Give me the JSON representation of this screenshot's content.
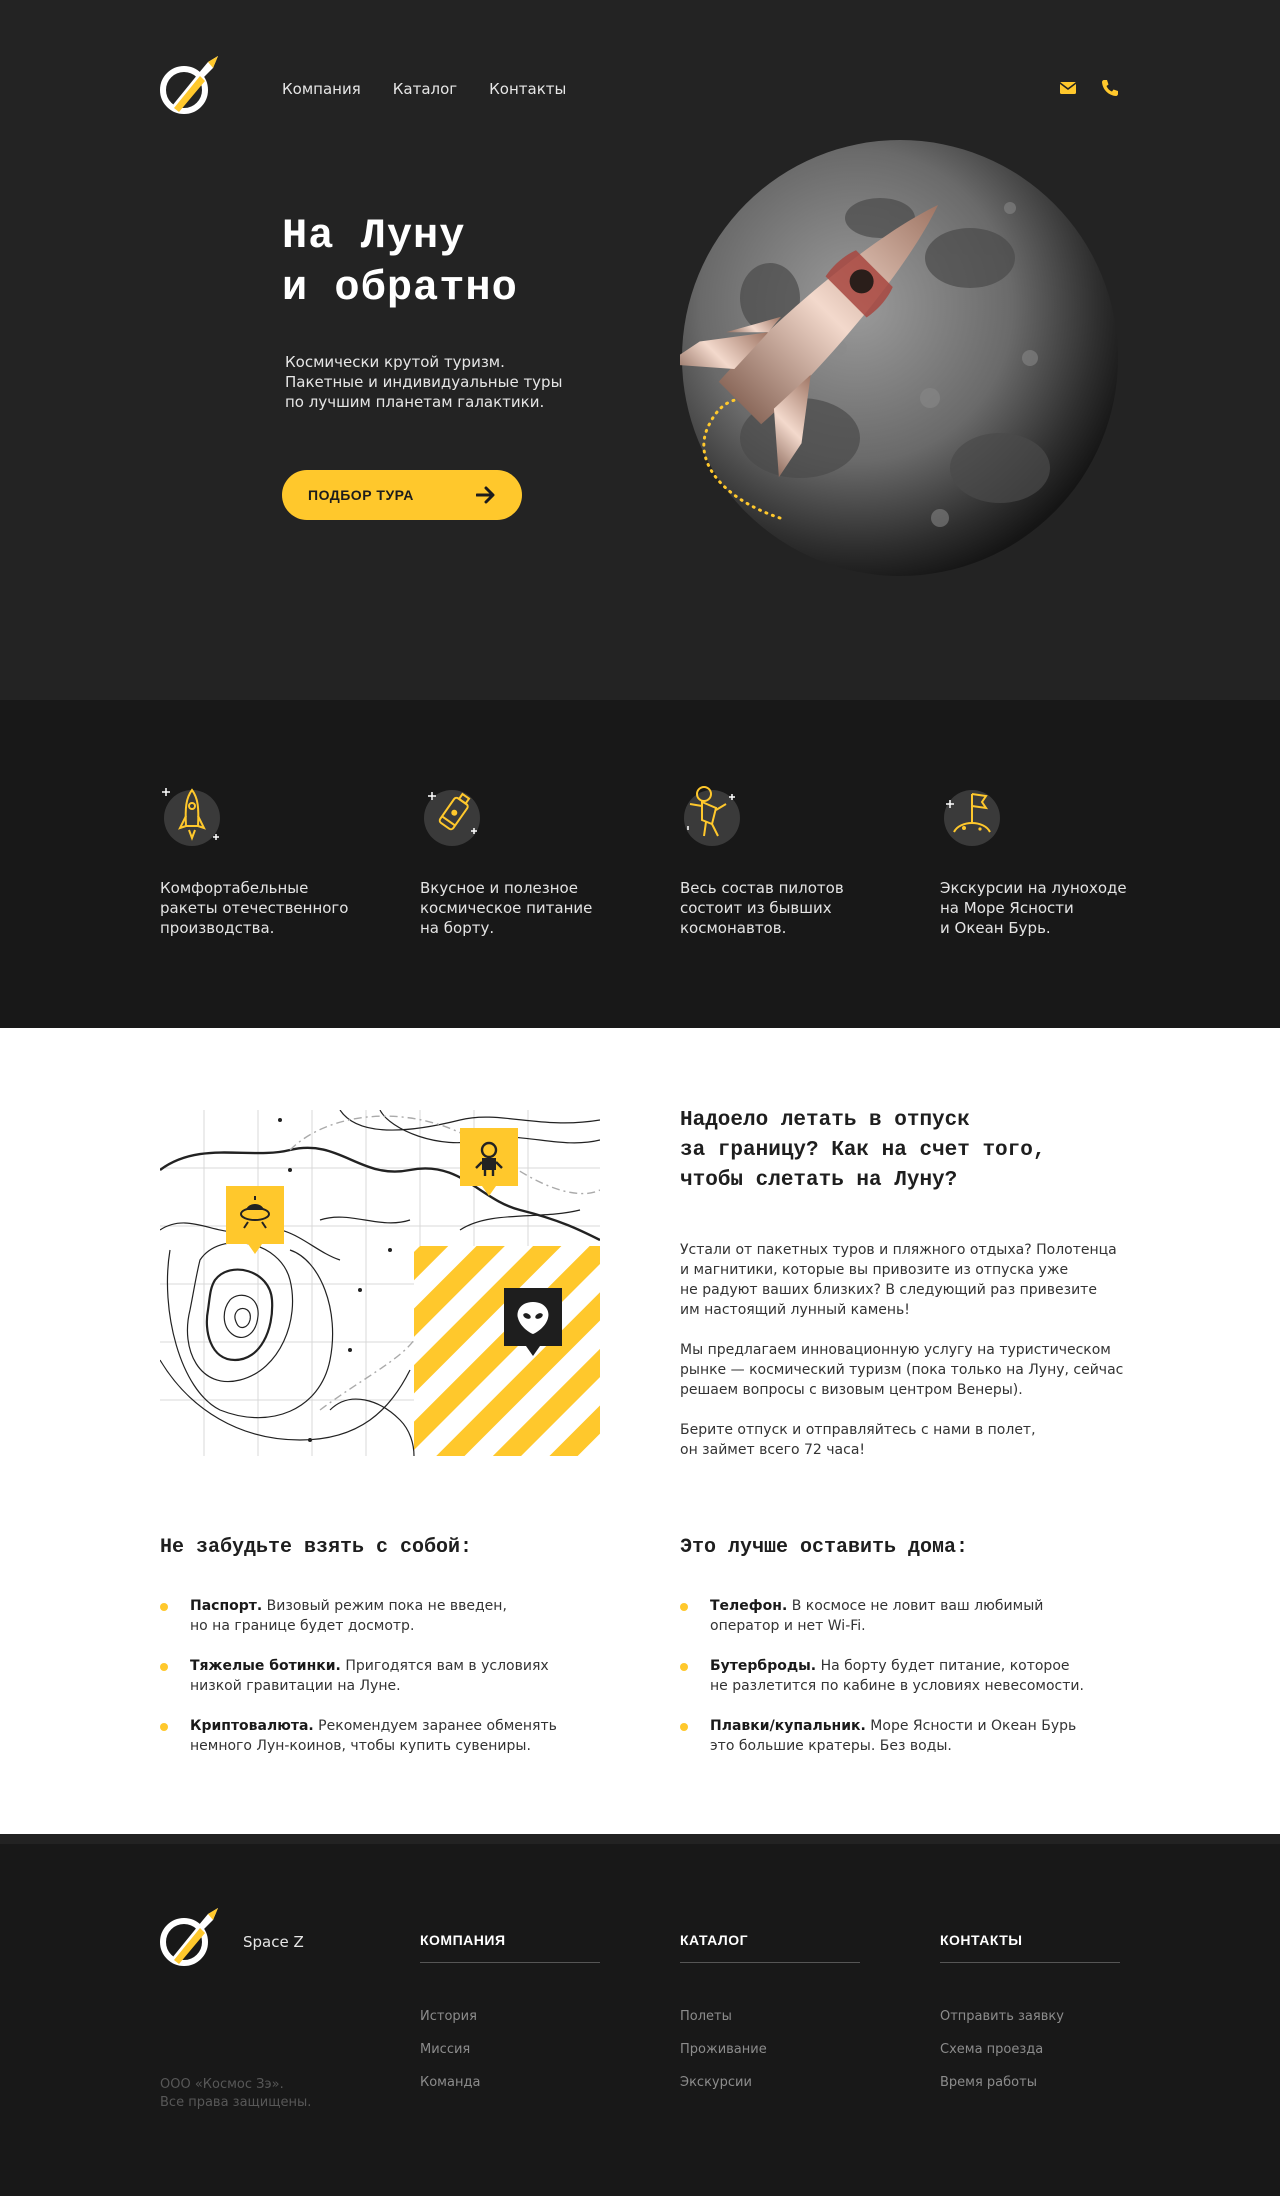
{
  "colors": {
    "accent": "#ffc82c",
    "hero_bg": "#232323",
    "dark_bg": "#181818"
  },
  "nav": {
    "items": [
      "Компания",
      "Каталог",
      "Контакты"
    ],
    "icons": [
      "mail-icon",
      "phone-icon"
    ]
  },
  "hero": {
    "title_lines": [
      "На Луну",
      "и обратно"
    ],
    "subtitle_lines": [
      "Космически крутой туризм.",
      "Пакетные и индивидуальные туры",
      "по лучшим планетам галактики."
    ],
    "cta_label": "ПОДБОР ТУРА"
  },
  "features": [
    {
      "icon": "rocket-icon",
      "lines": [
        "Комфортабельные",
        "ракеты отечественного",
        "производства."
      ]
    },
    {
      "icon": "food-tube-icon",
      "lines": [
        "Вкусное и полезное",
        "космическое питание",
        "на борту."
      ]
    },
    {
      "icon": "astronaut-icon",
      "lines": [
        "Весь состав пилотов",
        "состоит из бывших",
        "космонавтов."
      ]
    },
    {
      "icon": "moon-flag-icon",
      "lines": [
        "Экскурсии на луноходе",
        "на Море Ясности",
        "и Океан Бурь."
      ]
    }
  ],
  "info": {
    "title_lines": [
      "Надоело летать в отпуск",
      "за границу? Как на счет того,",
      "чтобы слетать на Луну?"
    ],
    "paragraphs": [
      [
        "Устали от пакетных туров и пляжного отдыха? Полотенца",
        "и магнитики, которые вы привозите из отпуска уже",
        "не радуют ваших близких? В следующий раз привезите",
        "им настоящий лунный камень!"
      ],
      [
        "Мы предлагаем инновационную услугу на туристическом",
        "рынке — космический туризм (пока только на Луну, сейчас",
        "решаем вопросы с визовым центром Венеры)."
      ],
      [
        "Берите отпуск и отправляйтесь с нами в полет,",
        "он займет всего 72 часа!"
      ]
    ]
  },
  "take_list": {
    "title": "Не забудьте взять с собой:",
    "items": [
      {
        "bold": "Паспорт.",
        "first": " Визовый режим пока не введен,",
        "rest": "но на границе будет досмотр."
      },
      {
        "bold": "Тяжелые ботинки.",
        "first": " Пригодятся вам в условиях",
        "rest": "низкой гравитации на Луне."
      },
      {
        "bold": "Криптовалюта.",
        "first": " Рекомендуем заранее обменять",
        "rest": "немного Лун-коинов, чтобы купить сувениры."
      }
    ]
  },
  "leave_list": {
    "title": "Это лучше оставить дома:",
    "items": [
      {
        "bold": "Телефон.",
        "first": " В космосе не ловит ваш любимый",
        "rest": "оператор и нет Wi-Fi."
      },
      {
        "bold": "Бутерброды.",
        "first": " На борту будет питание, которое",
        "rest": "не разлетится по кабине в условиях невесомости."
      },
      {
        "bold": "Плавки/купальник.",
        "first": " Море Ясности и Океан Бурь",
        "rest": "это большие кратеры. Без воды."
      }
    ]
  },
  "footer": {
    "brand": "Space Z",
    "legal_lines": [
      "ООО «Космос Зэ».",
      "Все права защищены."
    ],
    "columns": [
      {
        "title": "КОМПАНИЯ",
        "links": [
          "История",
          "Миссия",
          "Команда"
        ]
      },
      {
        "title": "КАТАЛОГ",
        "links": [
          "Полеты",
          "Проживание",
          "Экскурсии"
        ]
      },
      {
        "title": "КОНТАКТЫ",
        "links": [
          "Отправить заявку",
          "Схема проезда",
          "Время работы"
        ]
      }
    ]
  }
}
